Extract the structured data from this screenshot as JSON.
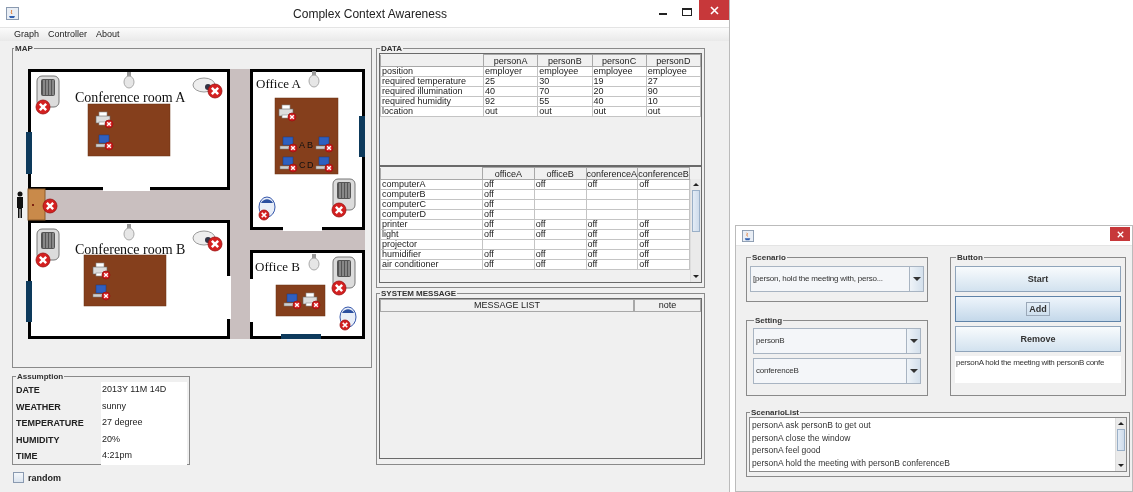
{
  "window": {
    "title": "Complex Context Awareness"
  },
  "menu": [
    "Graph",
    "Controller",
    "About"
  ],
  "map": {
    "title": "MAP",
    "entrance_door": {
      "on": false
    },
    "rooms": [
      {
        "name": "Conference room A",
        "devices": [
          {
            "kind": "heater",
            "on": false
          },
          {
            "kind": "projector",
            "on": false
          },
          {
            "kind": "light",
            "on": false
          },
          {
            "kind": "printer",
            "on": false
          },
          {
            "kind": "computer",
            "on": false
          }
        ]
      },
      {
        "name": "Office A",
        "devices": [
          {
            "kind": "light",
            "on": false
          },
          {
            "kind": "printer",
            "on": false
          },
          {
            "kind": "computer",
            "on": false,
            "label": "A"
          },
          {
            "kind": "computer",
            "on": false,
            "label": "B"
          },
          {
            "kind": "computer",
            "on": false,
            "label": "C"
          },
          {
            "kind": "computer",
            "on": false,
            "label": "D"
          },
          {
            "kind": "heater",
            "on": false
          },
          {
            "kind": "humidifier",
            "on": false
          }
        ]
      },
      {
        "name": "Conference room B",
        "devices": [
          {
            "kind": "heater",
            "on": false
          },
          {
            "kind": "projector",
            "on": false
          },
          {
            "kind": "light",
            "on": false
          },
          {
            "kind": "printer",
            "on": false
          },
          {
            "kind": "computer",
            "on": false
          }
        ]
      },
      {
        "name": "Office B",
        "devices": [
          {
            "kind": "light",
            "on": false
          },
          {
            "kind": "heater",
            "on": false
          },
          {
            "kind": "computer",
            "on": false
          },
          {
            "kind": "printer",
            "on": false
          },
          {
            "kind": "humidifier",
            "on": false
          }
        ]
      }
    ]
  },
  "assumption": {
    "title": "Assumption",
    "rows": [
      {
        "label": "DATE",
        "value": "2013Y 11M 14D"
      },
      {
        "label": "WEATHER",
        "value": "sunny"
      },
      {
        "label": "TEMPERATURE",
        "value": "27 degree"
      },
      {
        "label": "HUMIDITY",
        "value": "20%"
      },
      {
        "label": "TIME",
        "value": "4:21pm"
      }
    ]
  },
  "random": {
    "label": "random",
    "checked": false
  },
  "data": {
    "title": "DATA",
    "people": {
      "columns": [
        "personA",
        "personB",
        "personC",
        "personD"
      ],
      "rows": [
        {
          "label": "position",
          "cells": [
            "employer",
            "employee",
            "employee",
            "employee"
          ]
        },
        {
          "label": "required temperature",
          "cells": [
            "25",
            "30",
            "19",
            "27"
          ]
        },
        {
          "label": "required illumination",
          "cells": [
            "40",
            "70",
            "20",
            "90"
          ]
        },
        {
          "label": "required humidity",
          "cells": [
            "92",
            "55",
            "40",
            "10"
          ]
        },
        {
          "label": "location",
          "cells": [
            "out",
            "out",
            "out",
            "out"
          ]
        }
      ]
    },
    "devices": {
      "columns": [
        "officeA",
        "officeB",
        "conferenceA",
        "conferenceB"
      ],
      "rows": [
        {
          "label": "computerA",
          "cells": [
            "off",
            "off",
            "off",
            "off"
          ]
        },
        {
          "label": "computerB",
          "cells": [
            "off",
            null,
            null,
            null
          ]
        },
        {
          "label": "computerC",
          "cells": [
            "off",
            null,
            null,
            null
          ]
        },
        {
          "label": "computerD",
          "cells": [
            "off",
            null,
            null,
            null
          ]
        },
        {
          "label": "printer",
          "cells": [
            "off",
            "off",
            "off",
            "off"
          ]
        },
        {
          "label": "light",
          "cells": [
            "off",
            "off",
            "off",
            "off"
          ]
        },
        {
          "label": "projector",
          "cells": [
            null,
            null,
            "off",
            "off"
          ]
        },
        {
          "label": "humidifier",
          "cells": [
            "off",
            "off",
            "off",
            "off"
          ]
        },
        {
          "label": "air conditioner",
          "cells": [
            "off",
            "off",
            "off",
            "off"
          ]
        }
      ]
    }
  },
  "system_message": {
    "title": "SYSTEM MESSAGE",
    "columns": [
      "MESSAGE LIST",
      "note"
    ]
  },
  "dialog": {
    "scenario": {
      "title": "Scenario",
      "value": "[person, hold the meeting with, perso..."
    },
    "setting": {
      "title": "Setting",
      "values": [
        "personB",
        "conferenceB"
      ]
    },
    "buttons": {
      "title": "Button",
      "items": [
        {
          "label": "Start",
          "focused": false
        },
        {
          "label": "Add",
          "focused": true
        },
        {
          "label": "Remove",
          "focused": false
        }
      ]
    },
    "result": "personA hold the meeting with personB confe",
    "scenario_list": {
      "title": "ScenarioList",
      "items": [
        "personA ask personB to get out",
        "personA close the window",
        "personA feel good",
        "personA hold the meeting with personB conferenceB"
      ]
    }
  }
}
